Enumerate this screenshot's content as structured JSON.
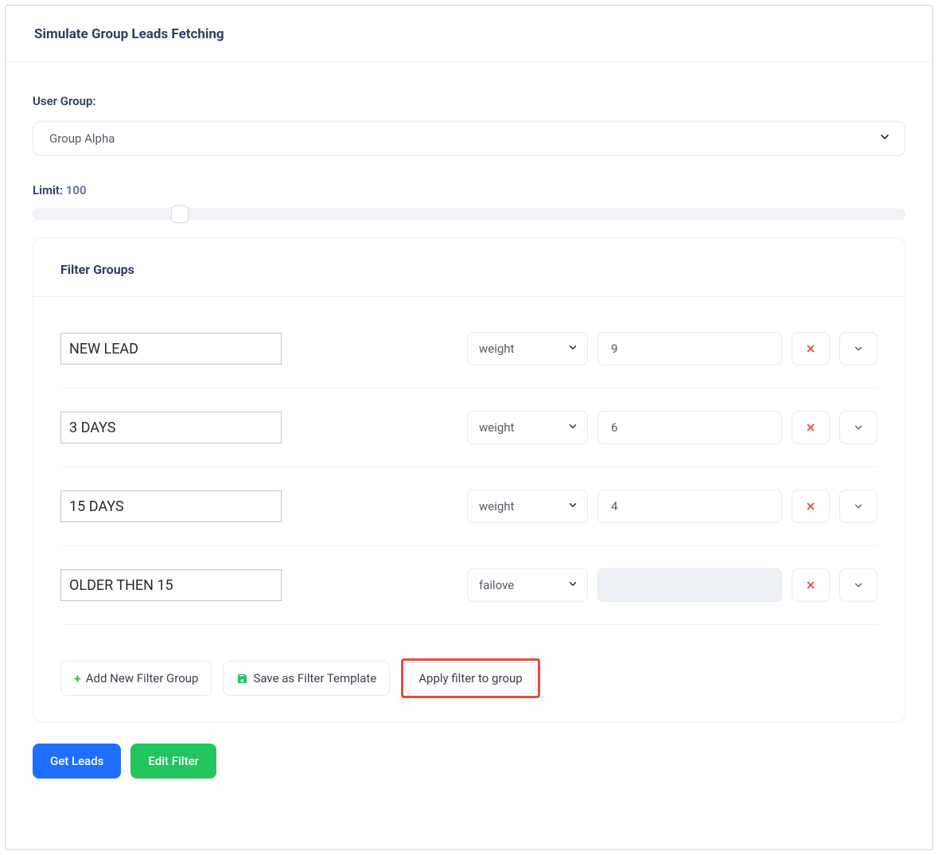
{
  "header": {
    "title": "Simulate Group Leads Fetching"
  },
  "userGroup": {
    "label": "User Group:",
    "selected": "Group Alpha"
  },
  "limit": {
    "labelPrefix": "Limit: ",
    "value": "100"
  },
  "filterGroups": {
    "title": "Filter Groups",
    "rows": [
      {
        "name": "NEW LEAD",
        "type": "weight",
        "value": "9",
        "disabled": false
      },
      {
        "name": "3 DAYS",
        "type": "weight",
        "value": "6",
        "disabled": false
      },
      {
        "name": "15 DAYS",
        "type": "weight",
        "value": "4",
        "disabled": false
      },
      {
        "name": "OLDER THEN 15",
        "type": "failove",
        "value": "",
        "disabled": true
      }
    ],
    "addBtn": "Add New Filter Group",
    "saveBtn": "Save as Filter Template",
    "applyBtn": "Apply filter to group"
  },
  "bottom": {
    "getLeads": "Get Leads",
    "editFilter": "Edit Filter"
  }
}
